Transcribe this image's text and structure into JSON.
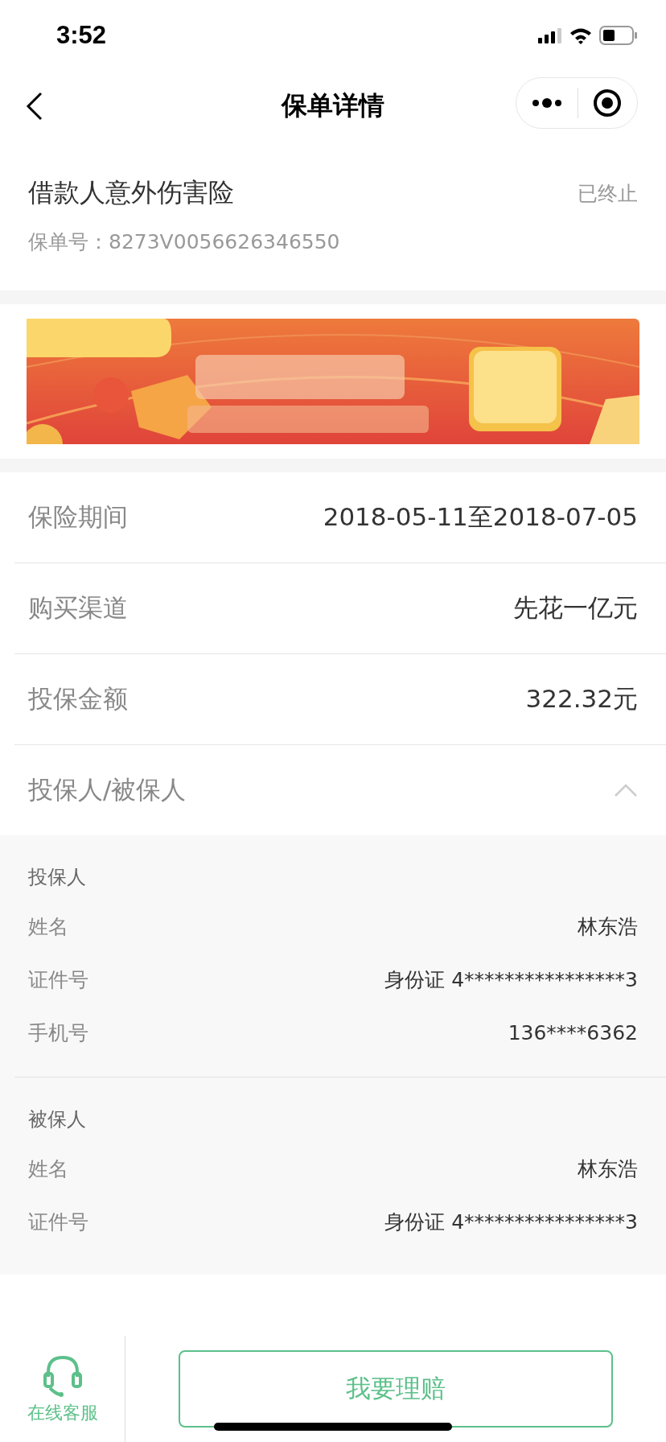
{
  "status_bar": {
    "time": "3:52"
  },
  "nav": {
    "title": "保单详情"
  },
  "policy": {
    "name": "借款人意外伤害险",
    "status": "已终止",
    "number_label": "保单号：",
    "number": "8273V0056626346550"
  },
  "info_rows": [
    {
      "label": "保险期间",
      "value": "2018-05-11至2018-07-05"
    },
    {
      "label": "购买渠道",
      "value": "先花一亿元"
    },
    {
      "label": "投保金额",
      "value": "322.32元"
    }
  ],
  "parties": {
    "label": "投保人/被保人",
    "expanded": true,
    "groups": [
      {
        "title": "投保人",
        "rows": [
          {
            "label": "姓名",
            "value": "林东浩"
          },
          {
            "label": "证件号",
            "value": "身份证 4****************3"
          },
          {
            "label": "手机号",
            "value": "136****6362"
          }
        ]
      },
      {
        "title": "被保人",
        "rows": [
          {
            "label": "姓名",
            "value": "林东浩"
          },
          {
            "label": "证件号",
            "value": "身份证 4****************3"
          }
        ]
      }
    ]
  },
  "bottom_bar": {
    "service_label": "在线客服",
    "claim_button": "我要理赔"
  }
}
